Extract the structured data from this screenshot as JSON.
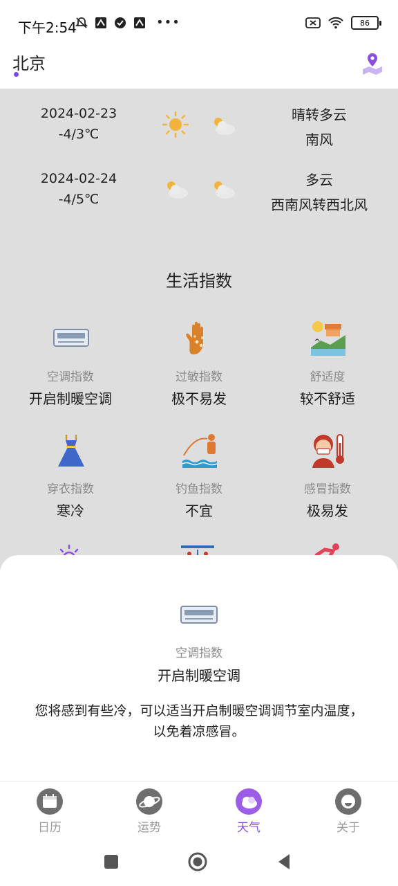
{
  "status": {
    "time": "下午2:54",
    "battery": "86"
  },
  "header": {
    "city": "北京"
  },
  "forecast": [
    {
      "date": "2024-02-23",
      "temp": "-4/3℃",
      "day_icon": "sunny-icon",
      "night_icon": "partly-cloudy-icon",
      "condition": "晴转多云",
      "wind": "南风"
    },
    {
      "date": "2024-02-24",
      "temp": "-4/5℃",
      "day_icon": "partly-cloudy-icon",
      "night_icon": "partly-cloudy-icon",
      "condition": "多云",
      "wind": "西南风转西北风"
    }
  ],
  "life": {
    "title": "生活指数",
    "items": [
      {
        "label": "空调指数",
        "value": "开启制暖空调",
        "icon": "air-conditioner-icon"
      },
      {
        "label": "过敏指数",
        "value": "极不易发",
        "icon": "allergy-hand-icon"
      },
      {
        "label": "舒适度",
        "value": "较不舒适",
        "icon": "comfort-landscape-icon"
      },
      {
        "label": "穿衣指数",
        "value": "寒冷",
        "icon": "dress-icon"
      },
      {
        "label": "钓鱼指数",
        "value": "不宜",
        "icon": "fishing-icon"
      },
      {
        "label": "感冒指数",
        "value": "极易发",
        "icon": "cold-sick-icon"
      }
    ]
  },
  "sheet": {
    "label": "空调指数",
    "value": "开启制暖空调",
    "description": "您将感到有些冷，可以适当开启制暖空调调节室内温度，以免着凉感冒。"
  },
  "tabs": [
    {
      "label": "日历",
      "icon": "calendar-icon"
    },
    {
      "label": "运势",
      "icon": "planet-icon"
    },
    {
      "label": "天气",
      "icon": "weather-cloud-icon"
    },
    {
      "label": "关于",
      "icon": "face-icon"
    }
  ],
  "colors": {
    "accent": "#8a4fe0",
    "background": "#dedede"
  }
}
